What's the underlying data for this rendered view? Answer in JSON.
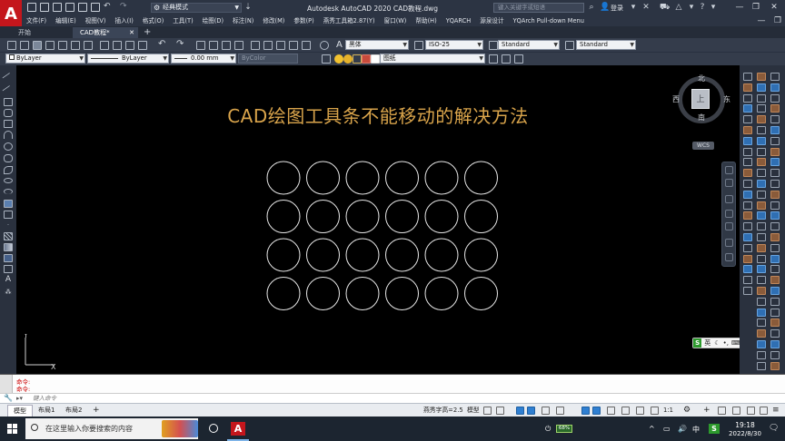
{
  "titlebar": {
    "workspace": "经典模式",
    "app_title": "Autodesk AutoCAD 2020    CAD教程.dwg",
    "search_placeholder": "键入关键字或短语",
    "login": "登录",
    "window_buttons": [
      "—",
      "❐",
      "✕"
    ]
  },
  "menu": {
    "items": [
      "文件(F)",
      "编辑(E)",
      "视图(V)",
      "插入(I)",
      "格式(O)",
      "工具(T)",
      "绘图(D)",
      "标注(N)",
      "修改(M)",
      "参数(P)",
      "燕秀工具箱2.87(Y)",
      "窗口(W)",
      "帮助(H)",
      "YQARCH",
      "源泉设计",
      "YQArch Pull-down Menu"
    ],
    "min_buttons": [
      "—",
      "❐",
      "✕"
    ]
  },
  "tabs": [
    {
      "label": "开始",
      "active": false
    },
    {
      "label": "CAD教程*",
      "active": true
    }
  ],
  "toolbar1": {
    "font": "黑体",
    "dimstyle": "ISO-25",
    "tablestyle": "Standard",
    "mleaderstyle": "Standard"
  },
  "toolbar2": {
    "layer_color": "ByLayer",
    "linetype": "ByLayer",
    "lineweight": "0.00 mm",
    "plotstyle": "ByColor",
    "current_layer": "图纸"
  },
  "drawing": {
    "title": "CAD绘图工具条不能移动的解决方法",
    "title_color": "#d9a44b",
    "circle_grid": {
      "rows": 4,
      "cols": 6
    }
  },
  "viewcube": {
    "face": "上",
    "north": "北",
    "south": "南",
    "east": "东",
    "west": "西",
    "wcs": "WCS"
  },
  "ucs": {
    "x": "X",
    "y": "Y"
  },
  "ime": {
    "logo": "S",
    "mode": "英"
  },
  "command": {
    "history": [
      "命令:",
      "命令:"
    ],
    "placeholder": "键入命令"
  },
  "status": {
    "layout_tabs": [
      "模型",
      "布局1",
      "布局2"
    ],
    "plus": "+",
    "text_height": "燕秀字高=2.5",
    "model": "模型",
    "scale": "1:1"
  },
  "taskbar": {
    "search_placeholder": "在这里输入你要搜索的内容",
    "battery": "68%",
    "lang": "中",
    "ime": "S",
    "time": "19:18",
    "date": "2022/8/30"
  },
  "colors": {
    "autocad_red": "#c4161c",
    "canvas": "#000000",
    "chrome": "#2c3443",
    "circle_stroke": "#e6e6e6"
  }
}
